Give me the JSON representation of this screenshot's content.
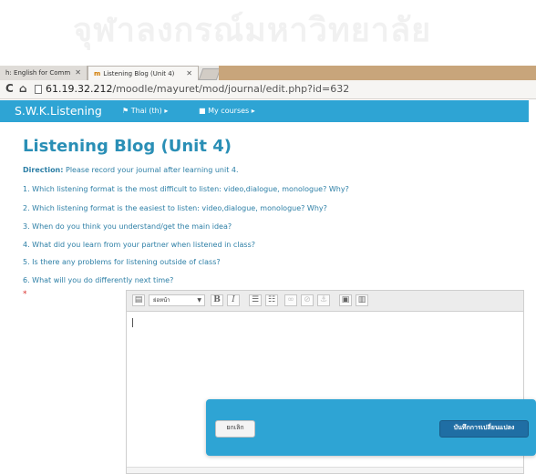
{
  "watermark": "จุฬาลงกรณ์มหาวิทยาลัย",
  "browser": {
    "tabs": [
      {
        "label": "h: English for Comm",
        "active": false
      },
      {
        "label": "Listening Blog (Unit 4)",
        "active": true
      }
    ],
    "url_host": "61.19.32.212",
    "url_path": "/moodle/mayuret/mod/journal/edit.php?id=632"
  },
  "navbar": {
    "brand": "S.W.K.Listening",
    "language": "Thai (th)",
    "my_courses": "My courses"
  },
  "page": {
    "title": "Listening Blog (Unit 4)",
    "direction_label": "Direction:",
    "direction_text": " Please record your journal after learning unit 4.",
    "questions": [
      "1. Which listening format is the most difficult to listen: video,dialogue, monologue? Why?",
      "2. Which listening format is the easiest to listen: video,dialogue, monologue? Why?",
      "3. When do you think you understand/get the main idea?",
      "4. What did you learn from your partner when listened in class?",
      "5. Is there any problems for listening outside of class?",
      "6. What will you do differently next time?"
    ],
    "required_marker": "*"
  },
  "editor": {
    "paragraph_select": "ย่อหน้า",
    "bold": "B",
    "italic": "I"
  },
  "actions": {
    "cancel": "ยกเลิก",
    "save": "บันทึกการเปลี่ยนแปลง"
  }
}
